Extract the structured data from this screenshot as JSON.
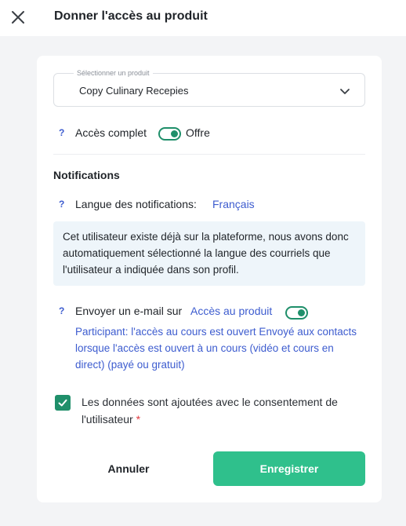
{
  "header": {
    "title": "Donner l'accès au produit",
    "close_icon": "close-icon"
  },
  "product_select": {
    "legend": "Sélectionner un produit",
    "value": "Copy Culinary Recepies",
    "chevron_icon": "chevron-down-icon"
  },
  "access": {
    "help": "?",
    "label": "Accès complet",
    "toggle_on": true,
    "toggle_label": "Offre"
  },
  "notifications": {
    "title": "Notifications",
    "language_help": "?",
    "language_label": "Langue des notifications:",
    "language_value": "Français",
    "info": "Cet utilisateur existe déjà sur la plateforme, nous avons donc automatiquement sélectionné la langue des courriels que l'utilisateur a indiquée dans son profil.",
    "email_help": "?",
    "email_label": "Envoyer un e-mail sur",
    "email_link": "Accès au produit",
    "email_toggle_on": true,
    "email_description": "Participant: l'accès au cours est ouvert Envoyé aux contacts lorsque l'accès est ouvert à un cours (vidéo et cours en direct) (payé ou gratuit)"
  },
  "consent": {
    "checked": true,
    "text": "Les données sont ajoutées avec le consentement de l'utilisateur",
    "required_mark": "*"
  },
  "actions": {
    "cancel_label": "Annuler",
    "save_label": "Enregistrer"
  },
  "colors": {
    "accent_green": "#2fc08c",
    "toggle_green": "#1f8f6a",
    "link_blue": "#3d5ccf",
    "info_bg": "#eef5fa",
    "required_red": "#e0393e"
  }
}
